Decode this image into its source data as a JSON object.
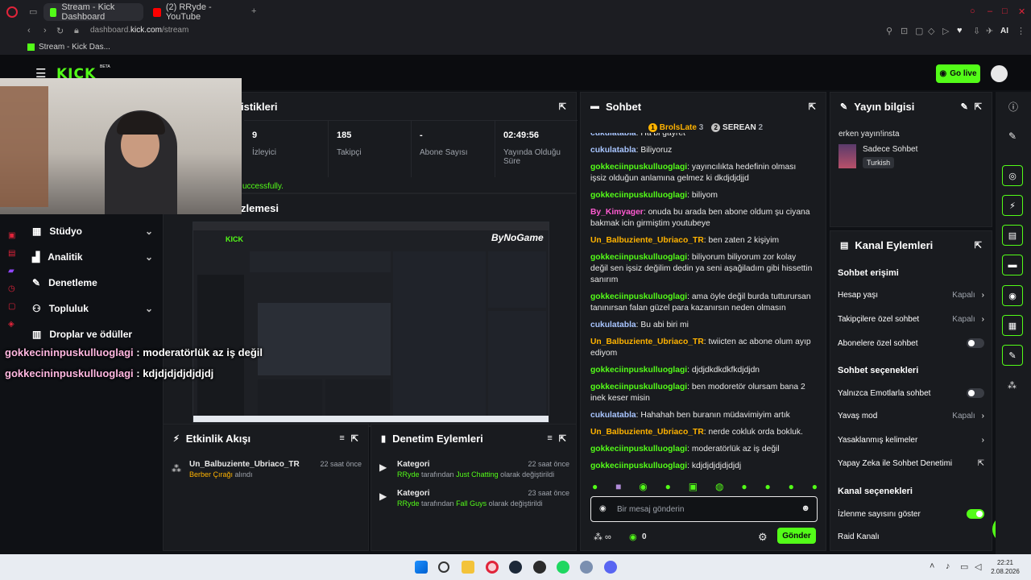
{
  "browser": {
    "tabs": [
      {
        "label": "Stream - Kick Dashboard"
      },
      {
        "label": "(2) RRyde - YouTube"
      }
    ],
    "url_prefix": "dashboard.",
    "url_domain": "kick.com",
    "url_path": "/stream",
    "bookmark": "Stream - Kick Das...",
    "ai_label": "AI"
  },
  "kick": {
    "beta": "BETA",
    "go_live": "Go live"
  },
  "stats": {
    "title_partial": "istikleri",
    "items": [
      {
        "value": "9",
        "label": "İzleyici"
      },
      {
        "value": "185",
        "label": "Takipçi"
      },
      {
        "value": "-",
        "label": "Abone Sayısı"
      },
      {
        "value": "02:49:56",
        "label": "Yayında Olduğu Süre"
      }
    ],
    "success_partial": "uccessfully."
  },
  "preview": {
    "title_partial": "zlemesi",
    "watermark": "ByNoGame"
  },
  "nav": {
    "items": [
      {
        "label": "Stüdyo"
      },
      {
        "label": "Analitik"
      },
      {
        "label": "Denetleme"
      },
      {
        "label": "Topluluk"
      },
      {
        "label": "Droplar ve ödüller"
      }
    ]
  },
  "overlay_chat": [
    {
      "user": "gokkecininpuskulluoglagi",
      "text": " : moderatörlük az iş değil"
    },
    {
      "user": "gokkecininpuskulluoglagi",
      "text": " : kdjdjdjdjdjdjdj"
    }
  ],
  "activity": {
    "title": "Etkinlik Akışı",
    "items": [
      {
        "user": "Un_Balbuziente_Ubriaco_TR",
        "time": "22 saat önce",
        "detail": "Berber Çırağı",
        "suffix": " alındı"
      }
    ]
  },
  "moderation": {
    "title": "Denetim Eylemleri",
    "items": [
      {
        "title": "Kategori",
        "time": "22 saat önce",
        "user": "RRyde",
        "mid": " tarafından ",
        "cat": "Just Chatting",
        "end": " olarak değiştirildi"
      },
      {
        "title": "Kategori",
        "time": "23 saat önce",
        "user": "RRyde",
        "mid": " tarafından ",
        "cat": "Fall Guys",
        "end": " olarak değiştirildi"
      }
    ]
  },
  "chat": {
    "title": "Sohbet",
    "pinned": [
      {
        "name": "BrolsLate",
        "count": "3",
        "rank": "1"
      },
      {
        "name": "SEREAN",
        "count": "2",
        "rank": "2"
      }
    ],
    "messages": [
      {
        "user": "cukulatabla",
        "color": "blue",
        "text": "Ha bi gayret"
      },
      {
        "user": "cukulatabla",
        "color": "blue",
        "text": "Biliyoruz"
      },
      {
        "user": "gokkeciinpuskulluoglagi",
        "color": "green",
        "text": "yayıncılıkta hedefinin olması işsiz olduğun anlamına gelmez ki dkdjdjdjjd"
      },
      {
        "user": "gokkeciinpuskulluoglagi",
        "color": "green",
        "text": "biliyom"
      },
      {
        "user": "By_Kimyager",
        "color": "pink",
        "text": "onuda bu arada ben abone oldum şu ciyana bakmak icin girmiştim youtubeye"
      },
      {
        "user": "Un_Balbuziente_Ubriaco_TR",
        "color": "yellow",
        "text": "ben zaten 2 kişiyim"
      },
      {
        "user": "gokkeciinpuskulluoglagi",
        "color": "green",
        "text": "biliyorum biliyorum zor kolay değil sen işsiz değilim dedin ya seni aşağiladım gibi hissettin sanırım"
      },
      {
        "user": "gokkeciinpuskulluoglagi",
        "color": "green",
        "text": "ama öyle değil burda tutturursan tanınırsan falan güzel para kazanırsın neden olmasın"
      },
      {
        "user": "cukulatabla",
        "color": "blue",
        "text": "Bu abi biri mi"
      },
      {
        "user": "Un_Balbuziente_Ubriaco_TR",
        "color": "yellow",
        "text": "twiicten ac abone olum ayıp ediyom"
      },
      {
        "user": "gokkeciinpuskulluoglagi",
        "color": "green",
        "text": "djdjdkdkdkfkdjdjdn"
      },
      {
        "user": "gokkeciinpuskulluoglagi",
        "color": "green",
        "text": "ben modoretör olursam bana 2 inek keser misin"
      },
      {
        "user": "cukulatabla",
        "color": "blue",
        "text": "Hahahah ben buranın müdavimiyim artık"
      },
      {
        "user": "Un_Balbuziente_Ubriaco_TR",
        "color": "yellow",
        "text": "nerde cokluk orda bokluk."
      },
      {
        "user": "gokkeciinpuskulluoglagi",
        "color": "green",
        "text": "moderatörlük az iş değil"
      },
      {
        "user": "gokkeciinpuskulluoglagi",
        "color": "green",
        "text": "kdjdjdjdjdjdjdj"
      }
    ],
    "placeholder": "Bir mesaj gönderin",
    "points": "0",
    "send": "Gönder"
  },
  "stream_info": {
    "title": "Yayın bilgisi",
    "stream_title": "erken yayın!insta",
    "category": "Sadece Sohbet",
    "language": "Turkish"
  },
  "channel_actions": {
    "title": "Kanal Eylemleri",
    "chat_access": "Sohbet erişimi",
    "account_age": "Hesap yaşı",
    "account_age_val": "Kapalı",
    "followers_only": "Takipçilere özel sohbet",
    "followers_only_val": "Kapalı",
    "subs_only": "Abonelere özel sohbet",
    "chat_options": "Sohbet seçenekleri",
    "emotes_only": "Yalnızca Emotlarla sohbet",
    "slow_mode": "Yavaş mod",
    "slow_mode_val": "Kapalı",
    "banned_words": "Yasaklanmış kelimeler",
    "ai_moderation": "Yapay Zeka ile Sohbet Denetimi",
    "channel_options": "Kanal seçenekleri",
    "show_viewers": "İzlenme sayısını göster",
    "raid": "Raid Kanalı"
  },
  "taskbar": {
    "time": "22:21",
    "date": "2.08.2026"
  },
  "colors": {
    "accent": "#53fc18",
    "panel": "#191b1f",
    "bg": "#0f1115"
  }
}
